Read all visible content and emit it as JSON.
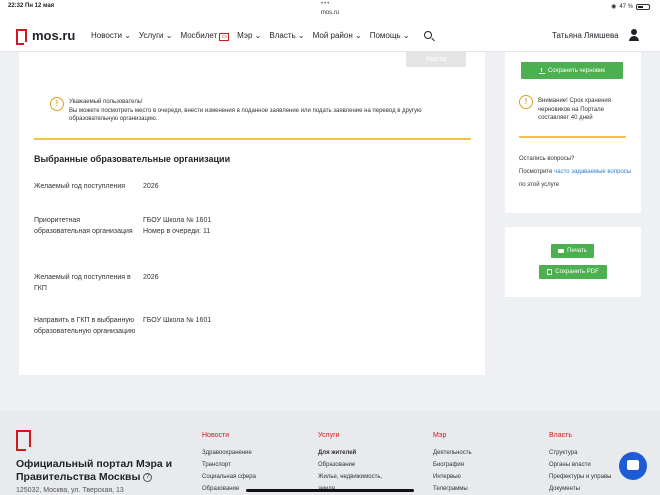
{
  "status_bar": {
    "time": "22:32  Пн 12 мая",
    "url": "mos.ru",
    "battery": "47 %",
    "battery_level": 0.47
  },
  "header": {
    "logo": "mos.ru",
    "nav": [
      "Новости",
      "Услуги",
      "Мосбилет",
      "Мэр",
      "Власть",
      "Мой район",
      "Помощь"
    ],
    "user": "Татьяна Лямшева"
  },
  "main": {
    "find_button": "Найти",
    "notice": "Уважаемый пользователь!\nВы можете посмотреть место в очереди, внести изменения в поданное заявление или подать заявление на перевод в другую образовательную организацию.",
    "section_title": "Выбранные образовательные организации",
    "rows": [
      {
        "label": "Желаемый год поступления",
        "value": "2026"
      },
      {
        "label": "Приоритетная образовательная организация",
        "value": "ГБОУ Школа № 1601\nНомер в очереди: 11"
      },
      {
        "label": "Желаемый год поступления в ГКП",
        "value": "2026"
      },
      {
        "label": "Направить в ГКП в выбранную образовательную организацию",
        "value": "ГБОУ Школа № 1601"
      }
    ]
  },
  "sidebar": {
    "save_draft": "Сохранить черновик",
    "storage_notice": "Внимание! Срок хранения черновиков на Портале составляет 40 дней",
    "questions_title": "Остались вопросы?",
    "faq_prefix": "Посмотрите ",
    "faq_link": "часто задаваемые вопросы",
    "faq_suffix": " по этой услуге",
    "print_button": "Печать",
    "pdf_button": "Сохранить PDF"
  },
  "footer": {
    "title": "Официальный портал Мэра и Правительства Москвы",
    "address": "125032, Москва, ул. Тверская, 13",
    "columns": [
      {
        "heading": "Новости",
        "items": [
          "Здравоохранение",
          "Транспорт",
          "Социальная сфера",
          "Образование"
        ]
      },
      {
        "heading": "Услуги",
        "items": [
          "Для жителей",
          "Образование",
          "Жилье, недвижимость,",
          "земля"
        ]
      },
      {
        "heading": "Мэр",
        "items": [
          "Деятельность",
          "Биография",
          "Интервью",
          "Телеграммы"
        ]
      },
      {
        "heading": "Власть",
        "items": [
          "Структура",
          "Органы власти",
          "Префектуры и управы",
          "Документы"
        ]
      }
    ]
  }
}
